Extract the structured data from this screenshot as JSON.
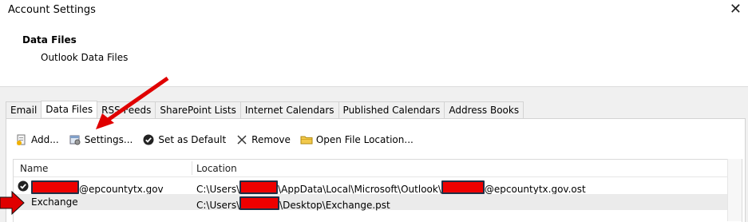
{
  "window": {
    "title": "Account Settings",
    "close_glyph": "✕"
  },
  "header": {
    "title": "Data Files",
    "subtitle": "Outlook Data Files"
  },
  "tabs": [
    {
      "label": "Email"
    },
    {
      "label": "Data Files",
      "active": true
    },
    {
      "label": "RSS Feeds"
    },
    {
      "label": "SharePoint Lists"
    },
    {
      "label": "Internet Calendars"
    },
    {
      "label": "Published Calendars"
    },
    {
      "label": "Address Books"
    }
  ],
  "toolbar": {
    "add_label": "Add...",
    "settings_label": "Settings...",
    "set_default_label": "Set as Default",
    "remove_label": "Remove",
    "open_location_label": "Open File Location..."
  },
  "list": {
    "columns": {
      "name": "Name",
      "location": "Location"
    },
    "rows": [
      {
        "default": true,
        "name_suffix": "@epcountytx.gov",
        "loc_part1": "C:\\Users\\",
        "loc_part2": "\\AppData\\Local\\Microsoft\\Outlook\\",
        "loc_part3": "@epcountytx.gov.ost"
      },
      {
        "default": false,
        "name": "Exchange",
        "loc_part1": "C:\\Users\\",
        "loc_part2": "\\Desktop\\Exchange.pst"
      }
    ]
  },
  "annotation": {
    "arrow_color": "#e00000",
    "redaction_color": "#ee0000"
  }
}
